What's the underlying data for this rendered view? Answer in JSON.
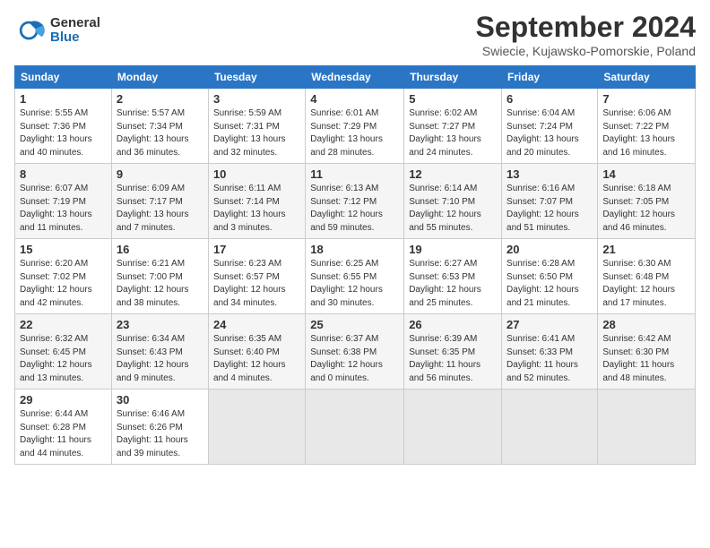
{
  "logo": {
    "general": "General",
    "blue": "Blue"
  },
  "header": {
    "month": "September 2024",
    "location": "Swiecie, Kujawsko-Pomorskie, Poland"
  },
  "days_of_week": [
    "Sunday",
    "Monday",
    "Tuesday",
    "Wednesday",
    "Thursday",
    "Friday",
    "Saturday"
  ],
  "weeks": [
    [
      {
        "day": "1",
        "sunrise": "Sunrise: 5:55 AM",
        "sunset": "Sunset: 7:36 PM",
        "daylight": "Daylight: 13 hours and 40 minutes."
      },
      {
        "day": "2",
        "sunrise": "Sunrise: 5:57 AM",
        "sunset": "Sunset: 7:34 PM",
        "daylight": "Daylight: 13 hours and 36 minutes."
      },
      {
        "day": "3",
        "sunrise": "Sunrise: 5:59 AM",
        "sunset": "Sunset: 7:31 PM",
        "daylight": "Daylight: 13 hours and 32 minutes."
      },
      {
        "day": "4",
        "sunrise": "Sunrise: 6:01 AM",
        "sunset": "Sunset: 7:29 PM",
        "daylight": "Daylight: 13 hours and 28 minutes."
      },
      {
        "day": "5",
        "sunrise": "Sunrise: 6:02 AM",
        "sunset": "Sunset: 7:27 PM",
        "daylight": "Daylight: 13 hours and 24 minutes."
      },
      {
        "day": "6",
        "sunrise": "Sunrise: 6:04 AM",
        "sunset": "Sunset: 7:24 PM",
        "daylight": "Daylight: 13 hours and 20 minutes."
      },
      {
        "day": "7",
        "sunrise": "Sunrise: 6:06 AM",
        "sunset": "Sunset: 7:22 PM",
        "daylight": "Daylight: 13 hours and 16 minutes."
      }
    ],
    [
      {
        "day": "8",
        "sunrise": "Sunrise: 6:07 AM",
        "sunset": "Sunset: 7:19 PM",
        "daylight": "Daylight: 13 hours and 11 minutes."
      },
      {
        "day": "9",
        "sunrise": "Sunrise: 6:09 AM",
        "sunset": "Sunset: 7:17 PM",
        "daylight": "Daylight: 13 hours and 7 minutes."
      },
      {
        "day": "10",
        "sunrise": "Sunrise: 6:11 AM",
        "sunset": "Sunset: 7:14 PM",
        "daylight": "Daylight: 13 hours and 3 minutes."
      },
      {
        "day": "11",
        "sunrise": "Sunrise: 6:13 AM",
        "sunset": "Sunset: 7:12 PM",
        "daylight": "Daylight: 12 hours and 59 minutes."
      },
      {
        "day": "12",
        "sunrise": "Sunrise: 6:14 AM",
        "sunset": "Sunset: 7:10 PM",
        "daylight": "Daylight: 12 hours and 55 minutes."
      },
      {
        "day": "13",
        "sunrise": "Sunrise: 6:16 AM",
        "sunset": "Sunset: 7:07 PM",
        "daylight": "Daylight: 12 hours and 51 minutes."
      },
      {
        "day": "14",
        "sunrise": "Sunrise: 6:18 AM",
        "sunset": "Sunset: 7:05 PM",
        "daylight": "Daylight: 12 hours and 46 minutes."
      }
    ],
    [
      {
        "day": "15",
        "sunrise": "Sunrise: 6:20 AM",
        "sunset": "Sunset: 7:02 PM",
        "daylight": "Daylight: 12 hours and 42 minutes."
      },
      {
        "day": "16",
        "sunrise": "Sunrise: 6:21 AM",
        "sunset": "Sunset: 7:00 PM",
        "daylight": "Daylight: 12 hours and 38 minutes."
      },
      {
        "day": "17",
        "sunrise": "Sunrise: 6:23 AM",
        "sunset": "Sunset: 6:57 PM",
        "daylight": "Daylight: 12 hours and 34 minutes."
      },
      {
        "day": "18",
        "sunrise": "Sunrise: 6:25 AM",
        "sunset": "Sunset: 6:55 PM",
        "daylight": "Daylight: 12 hours and 30 minutes."
      },
      {
        "day": "19",
        "sunrise": "Sunrise: 6:27 AM",
        "sunset": "Sunset: 6:53 PM",
        "daylight": "Daylight: 12 hours and 25 minutes."
      },
      {
        "day": "20",
        "sunrise": "Sunrise: 6:28 AM",
        "sunset": "Sunset: 6:50 PM",
        "daylight": "Daylight: 12 hours and 21 minutes."
      },
      {
        "day": "21",
        "sunrise": "Sunrise: 6:30 AM",
        "sunset": "Sunset: 6:48 PM",
        "daylight": "Daylight: 12 hours and 17 minutes."
      }
    ],
    [
      {
        "day": "22",
        "sunrise": "Sunrise: 6:32 AM",
        "sunset": "Sunset: 6:45 PM",
        "daylight": "Daylight: 12 hours and 13 minutes."
      },
      {
        "day": "23",
        "sunrise": "Sunrise: 6:34 AM",
        "sunset": "Sunset: 6:43 PM",
        "daylight": "Daylight: 12 hours and 9 minutes."
      },
      {
        "day": "24",
        "sunrise": "Sunrise: 6:35 AM",
        "sunset": "Sunset: 6:40 PM",
        "daylight": "Daylight: 12 hours and 4 minutes."
      },
      {
        "day": "25",
        "sunrise": "Sunrise: 6:37 AM",
        "sunset": "Sunset: 6:38 PM",
        "daylight": "Daylight: 12 hours and 0 minutes."
      },
      {
        "day": "26",
        "sunrise": "Sunrise: 6:39 AM",
        "sunset": "Sunset: 6:35 PM",
        "daylight": "Daylight: 11 hours and 56 minutes."
      },
      {
        "day": "27",
        "sunrise": "Sunrise: 6:41 AM",
        "sunset": "Sunset: 6:33 PM",
        "daylight": "Daylight: 11 hours and 52 minutes."
      },
      {
        "day": "28",
        "sunrise": "Sunrise: 6:42 AM",
        "sunset": "Sunset: 6:30 PM",
        "daylight": "Daylight: 11 hours and 48 minutes."
      }
    ],
    [
      {
        "day": "29",
        "sunrise": "Sunrise: 6:44 AM",
        "sunset": "Sunset: 6:28 PM",
        "daylight": "Daylight: 11 hours and 44 minutes."
      },
      {
        "day": "30",
        "sunrise": "Sunrise: 6:46 AM",
        "sunset": "Sunset: 6:26 PM",
        "daylight": "Daylight: 11 hours and 39 minutes."
      },
      null,
      null,
      null,
      null,
      null
    ]
  ]
}
